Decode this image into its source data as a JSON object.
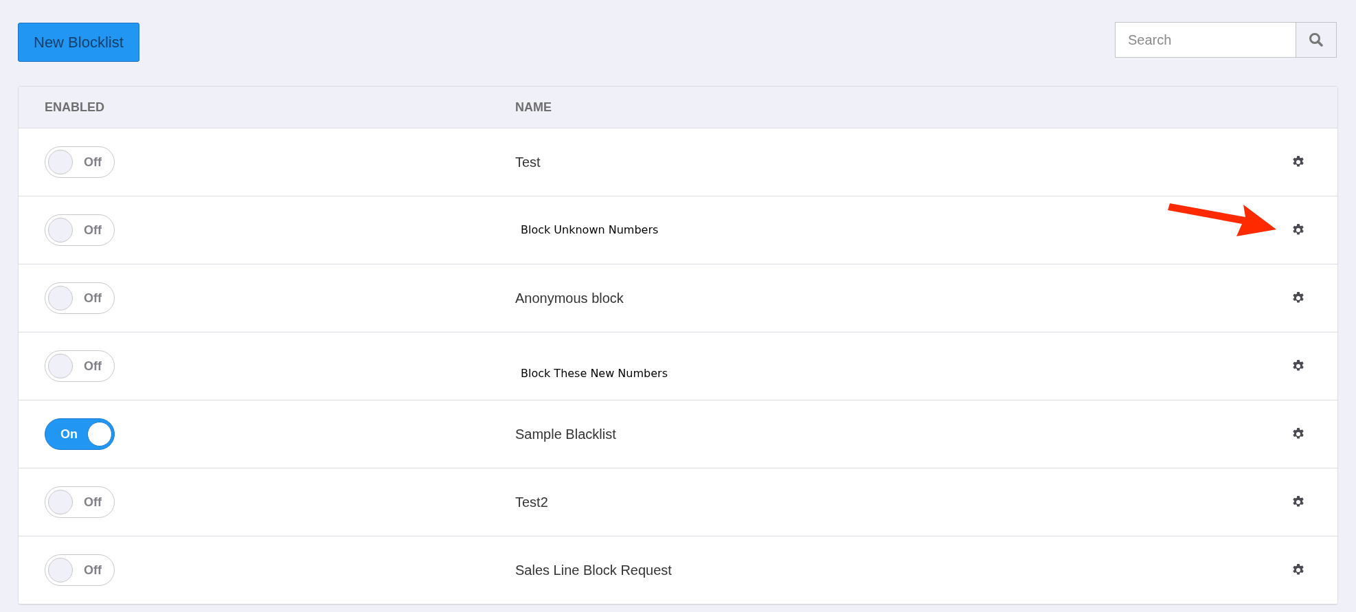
{
  "toolbar": {
    "new_button": "New Blocklist",
    "search": {
      "placeholder": "Search"
    }
  },
  "table": {
    "columns": [
      "ENABLED",
      "NAME"
    ],
    "rows": [
      {
        "enabled": false,
        "toggle_label": "Off",
        "name": "Test",
        "kind": "plain"
      },
      {
        "enabled": false,
        "toggle_label": "Off",
        "name": "Block Unknown Numbers",
        "kind": "pasted"
      },
      {
        "enabled": false,
        "toggle_label": "Off",
        "name": "Anonymous block",
        "kind": "plain"
      },
      {
        "enabled": false,
        "toggle_label": "Off",
        "name": "Block These New Numbers",
        "kind": "pasted"
      },
      {
        "enabled": true,
        "toggle_label": "On",
        "name": "Sample Blacklist",
        "kind": "plain"
      },
      {
        "enabled": false,
        "toggle_label": "Off",
        "name": "Test2",
        "kind": "plain"
      },
      {
        "enabled": false,
        "toggle_label": "Off",
        "name": "Sales Line Block Request",
        "kind": "plain"
      }
    ]
  }
}
